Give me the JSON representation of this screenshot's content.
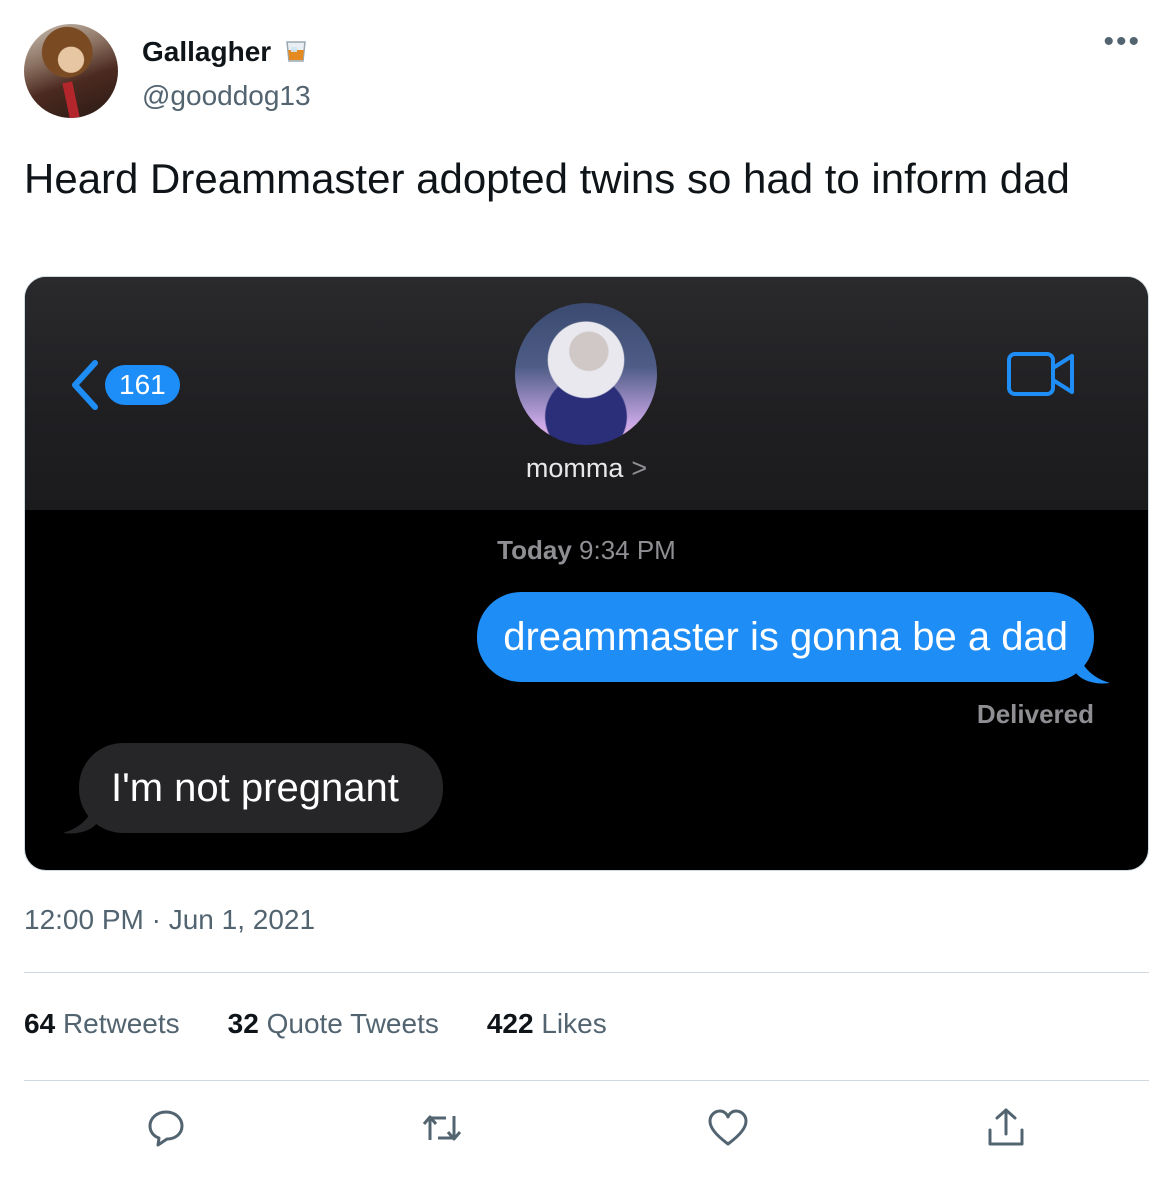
{
  "tweet": {
    "display_name": "Gallagher",
    "name_badge_icon": "whiskey-glass-emoji",
    "handle": "@gooddog13",
    "text": "Heard Dreammaster adopted twins so had to inform dad",
    "timestamp": "12:00 PM · Jun 1, 2021",
    "more_icon": "ellipsis-icon"
  },
  "screenshot": {
    "back_count": "161",
    "contact_name": "momma",
    "contact_chevron": ">",
    "time_day": "Today",
    "time_clock": "9:34 PM",
    "outgoing_message": "dreammaster is gonna be a dad",
    "delivered_label": "Delivered",
    "incoming_message": "I'm not pregnant",
    "accent_color": "#1e8df6"
  },
  "stats": [
    {
      "count": "64",
      "label": "Retweets"
    },
    {
      "count": "32",
      "label": "Quote Tweets"
    },
    {
      "count": "422",
      "label": "Likes"
    }
  ],
  "actions": [
    "reply-icon",
    "retweet-icon",
    "like-icon",
    "share-icon"
  ]
}
